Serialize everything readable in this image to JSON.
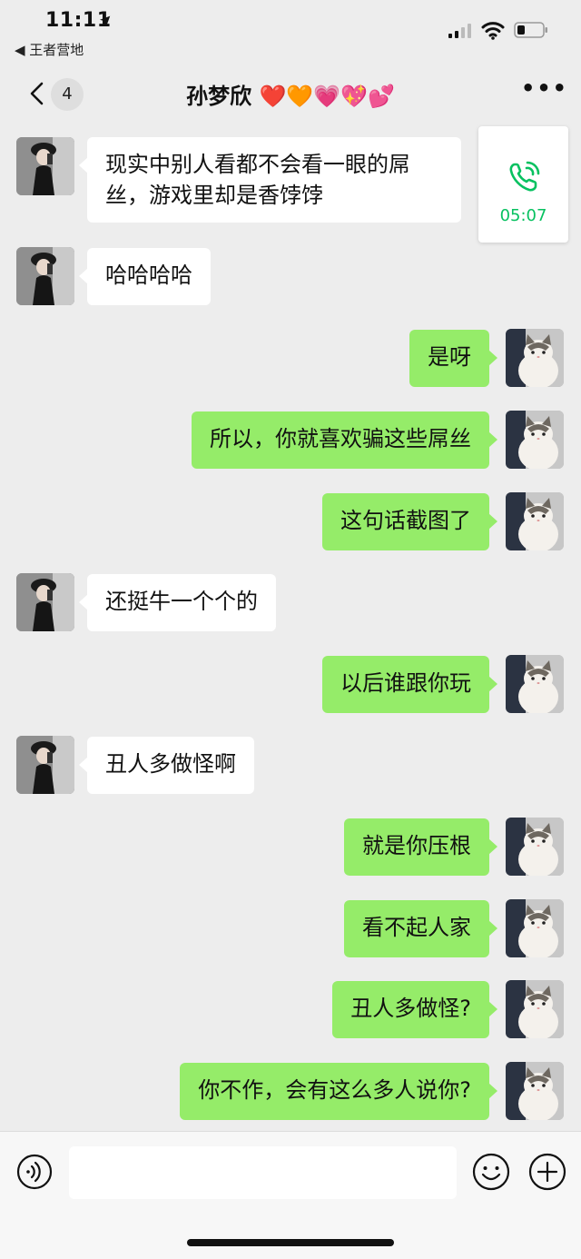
{
  "status_bar": {
    "time": "11:11",
    "location_arrow": "➤",
    "back_app_label": "◀ 王者营地"
  },
  "nav": {
    "unread_count": "4",
    "title": "孙梦欣 ❤️🧡💗💖💕"
  },
  "call_card": {
    "duration": "05:07",
    "icon": "phone-call-icon",
    "accent_color": "#07c160"
  },
  "messages": [
    {
      "side": "in",
      "text": "现实中别人看都不会看一眼的屌丝，游戏里却是香饽饽"
    },
    {
      "side": "in",
      "text": "哈哈哈哈"
    },
    {
      "side": "out",
      "text": "是呀"
    },
    {
      "side": "out",
      "text": "所以，你就喜欢骗这些屌丝"
    },
    {
      "side": "out",
      "text": "这句话截图了"
    },
    {
      "side": "in",
      "text": "还挺牛一个个的"
    },
    {
      "side": "out",
      "text": "以后谁跟你玩"
    },
    {
      "side": "in",
      "text": "丑人多做怪啊"
    },
    {
      "side": "out",
      "text": "就是你压根"
    },
    {
      "side": "out",
      "text": "看不起人家"
    },
    {
      "side": "out",
      "text": "丑人多做怪?"
    },
    {
      "side": "out",
      "text": "你不作，会有这么多人说你?"
    }
  ],
  "colors": {
    "incoming_bubble": "#ffffff",
    "outgoing_bubble": "#95ec69",
    "background": "#ededed"
  },
  "input_bar": {
    "voice_icon": "voice-icon",
    "emoji_icon": "emoji-icon",
    "plus_icon": "plus-icon"
  }
}
